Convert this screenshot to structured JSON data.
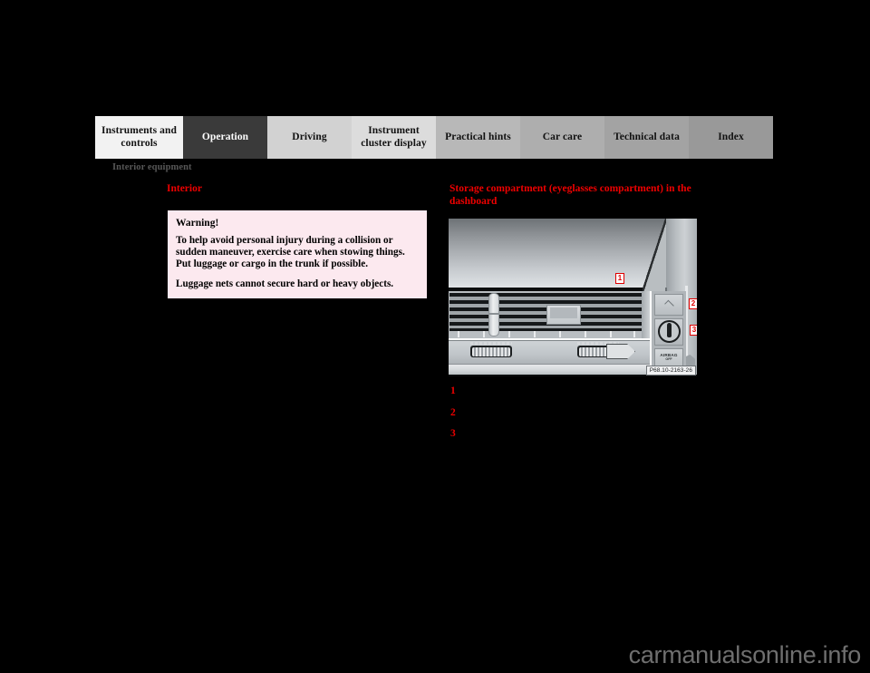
{
  "tabs": [
    {
      "label": "Instruments and controls",
      "active": false,
      "bg": "#f2f2f2",
      "width": 97
    },
    {
      "label": "Operation",
      "active": true,
      "bg": "#3a3a3a",
      "width": 93
    },
    {
      "label": "Driving",
      "active": false,
      "bg": "#d2d2d2",
      "width": 93
    },
    {
      "label": "Instrument cluster display",
      "active": false,
      "bg": "#dcdcdc",
      "width": 93
    },
    {
      "label": "Practical hints",
      "active": false,
      "bg": "#b8b8b8",
      "width": 93
    },
    {
      "label": "Car care",
      "active": false,
      "bg": "#aeaeae",
      "width": 93
    },
    {
      "label": "Technical data",
      "active": false,
      "bg": "#a3a3a3",
      "width": 93
    },
    {
      "label": "Index",
      "active": false,
      "bg": "#999999",
      "width": 93
    }
  ],
  "section": {
    "header": "Interior equipment"
  },
  "left_column": {
    "heading": "Interior",
    "warning": {
      "title": "Warning!",
      "paragraphs": [
        "To help avoid personal injury during a collision or sudden maneuver, exercise care when stowing things. Put luggage or cargo in the trunk if possible.",
        "Luggage nets cannot secure hard or heavy objects."
      ]
    }
  },
  "right_column": {
    "heading": "Storage compartment (eyeglasses compartment) in the dashboard",
    "figure": {
      "code": "P68.10-2163-26",
      "airbag_button_line1": "AIRBAG",
      "airbag_button_line2": "OFF",
      "callouts": [
        "1",
        "2",
        "3"
      ]
    },
    "numbered_list": [
      {
        "marker": "1",
        "text": ""
      },
      {
        "marker": "2",
        "text": ""
      },
      {
        "marker": "3",
        "text": ""
      }
    ]
  },
  "watermark": "carmanualsonline.info",
  "colors": {
    "accent_red": "#ee0000",
    "warning_bg": "#fce9ef",
    "active_tab_bg": "#3a3a3a",
    "page_bg": "#000000",
    "header_gray": "#575757"
  }
}
